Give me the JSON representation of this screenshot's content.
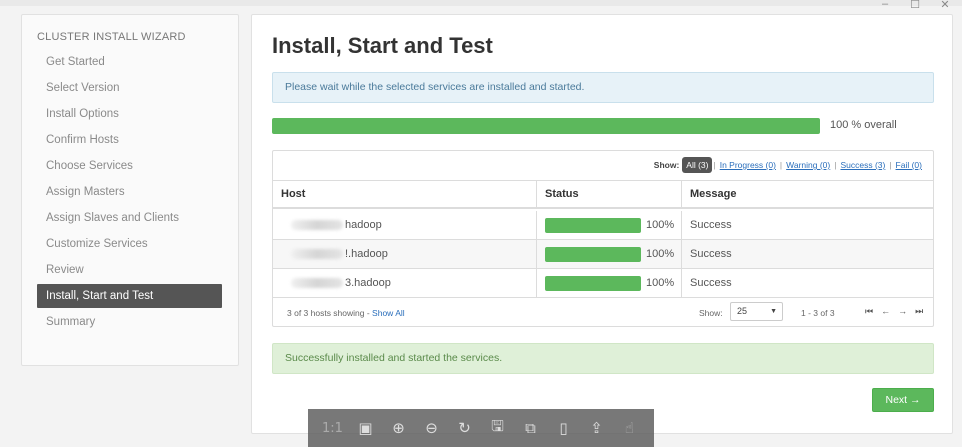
{
  "window": {
    "controls": {
      "minimize": "–",
      "maximize": "☐",
      "close": "✕"
    }
  },
  "sidebar": {
    "title": "CLUSTER INSTALL WIZARD",
    "items": [
      {
        "label": "Get Started",
        "active": false
      },
      {
        "label": "Select Version",
        "active": false
      },
      {
        "label": "Install Options",
        "active": false
      },
      {
        "label": "Confirm Hosts",
        "active": false
      },
      {
        "label": "Choose Services",
        "active": false
      },
      {
        "label": "Assign Masters",
        "active": false
      },
      {
        "label": "Assign Slaves and Clients",
        "active": false
      },
      {
        "label": "Customize Services",
        "active": false
      },
      {
        "label": "Review",
        "active": false
      },
      {
        "label": "Install, Start and Test",
        "active": true
      },
      {
        "label": "Summary",
        "active": false
      }
    ]
  },
  "main": {
    "title": "Install, Start and Test",
    "info_message": "Please wait while the selected services are installed and started.",
    "overall_progress": 100,
    "overall_label": "100 % overall",
    "filter": {
      "show_label": "Show:",
      "all": "All (3)",
      "in_progress": "In Progress (0)",
      "warning": "Warning (0)",
      "success": "Success (3)",
      "fail": "Fail (0)"
    },
    "table": {
      "headers": {
        "host": "Host",
        "status": "Status",
        "message": "Message"
      },
      "rows": [
        {
          "host": "hadoop",
          "progress": 100,
          "pct_label": "100%",
          "message": "Success"
        },
        {
          "host": "!.hadoop",
          "progress": 100,
          "pct_label": "100%",
          "message": "Success"
        },
        {
          "host": "3.hadoop",
          "progress": 100,
          "pct_label": "100%",
          "message": "Success"
        }
      ],
      "footer": {
        "count_text": "3 of 3 hosts showing - ",
        "show_all": "Show All",
        "show_label": "Show:",
        "page_size": "25",
        "range": "1 - 3 of 3",
        "pager": {
          "first": "⏮",
          "prev": "←",
          "next": "→",
          "last": "⏭"
        }
      }
    },
    "success_message": "Successfully installed and started the services.",
    "next_button": "Next →"
  },
  "viewer_toolbar": {
    "items": [
      {
        "name": "actual-size-icon",
        "glyph": "1:1"
      },
      {
        "name": "fit-screen-icon",
        "glyph": "▣"
      },
      {
        "name": "zoom-in-icon",
        "glyph": "⊕"
      },
      {
        "name": "zoom-out-icon",
        "glyph": "⊖"
      },
      {
        "name": "rotate-icon",
        "glyph": "↻"
      },
      {
        "name": "save-icon",
        "glyph": "🖫"
      },
      {
        "name": "bookmark-icon",
        "glyph": "⧉"
      },
      {
        "name": "slideshow-icon",
        "glyph": "▯"
      },
      {
        "name": "share-icon",
        "glyph": "⇪"
      },
      {
        "name": "touch-icon",
        "glyph": "☝"
      }
    ]
  },
  "colors": {
    "progress_green": "#5cb85c",
    "active_sidebar": "#555555",
    "info_bg": "#e7f2f8",
    "success_bg": "#dff0d8",
    "link_blue": "#2a6ebb"
  }
}
